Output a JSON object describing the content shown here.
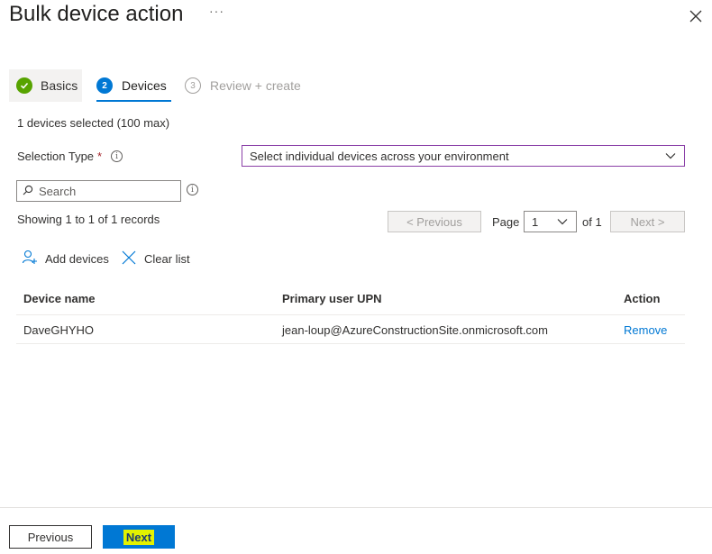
{
  "header": {
    "title": "Bulk device action",
    "more": "···"
  },
  "wizard": {
    "steps": [
      {
        "label": "Basics",
        "state": "completed"
      },
      {
        "number": "2",
        "label": "Devices",
        "state": "active"
      },
      {
        "number": "3",
        "label": "Review + create",
        "state": "upcoming"
      }
    ]
  },
  "devices": {
    "selected_count": "1 devices selected (100 max)",
    "selection_type_label": "Selection Type",
    "required_marker": "*",
    "selection_type_value": "Select individual devices across your environment",
    "search_placeholder": "Search",
    "showing": "Showing 1 to 1 of 1 records",
    "pagination": {
      "previous": "< Previous",
      "page_label": "Page",
      "page_value": "1",
      "of_label": "of 1",
      "next": "Next >"
    },
    "commands": {
      "add": "Add devices",
      "clear": "Clear list"
    },
    "table": {
      "headers": [
        "Device name",
        "Primary user UPN",
        "Action"
      ],
      "rows": [
        {
          "device_name": "DaveGHYHO",
          "upn": "jean-loup@AzureConstructionSite.onmicrosoft.com",
          "action": "Remove"
        }
      ]
    }
  },
  "footer": {
    "previous": "Previous",
    "next": "Next"
  },
  "colors": {
    "accent": "#0078d4",
    "success": "#57a300",
    "required": "#a4262c",
    "highlight": "#e2f200"
  }
}
